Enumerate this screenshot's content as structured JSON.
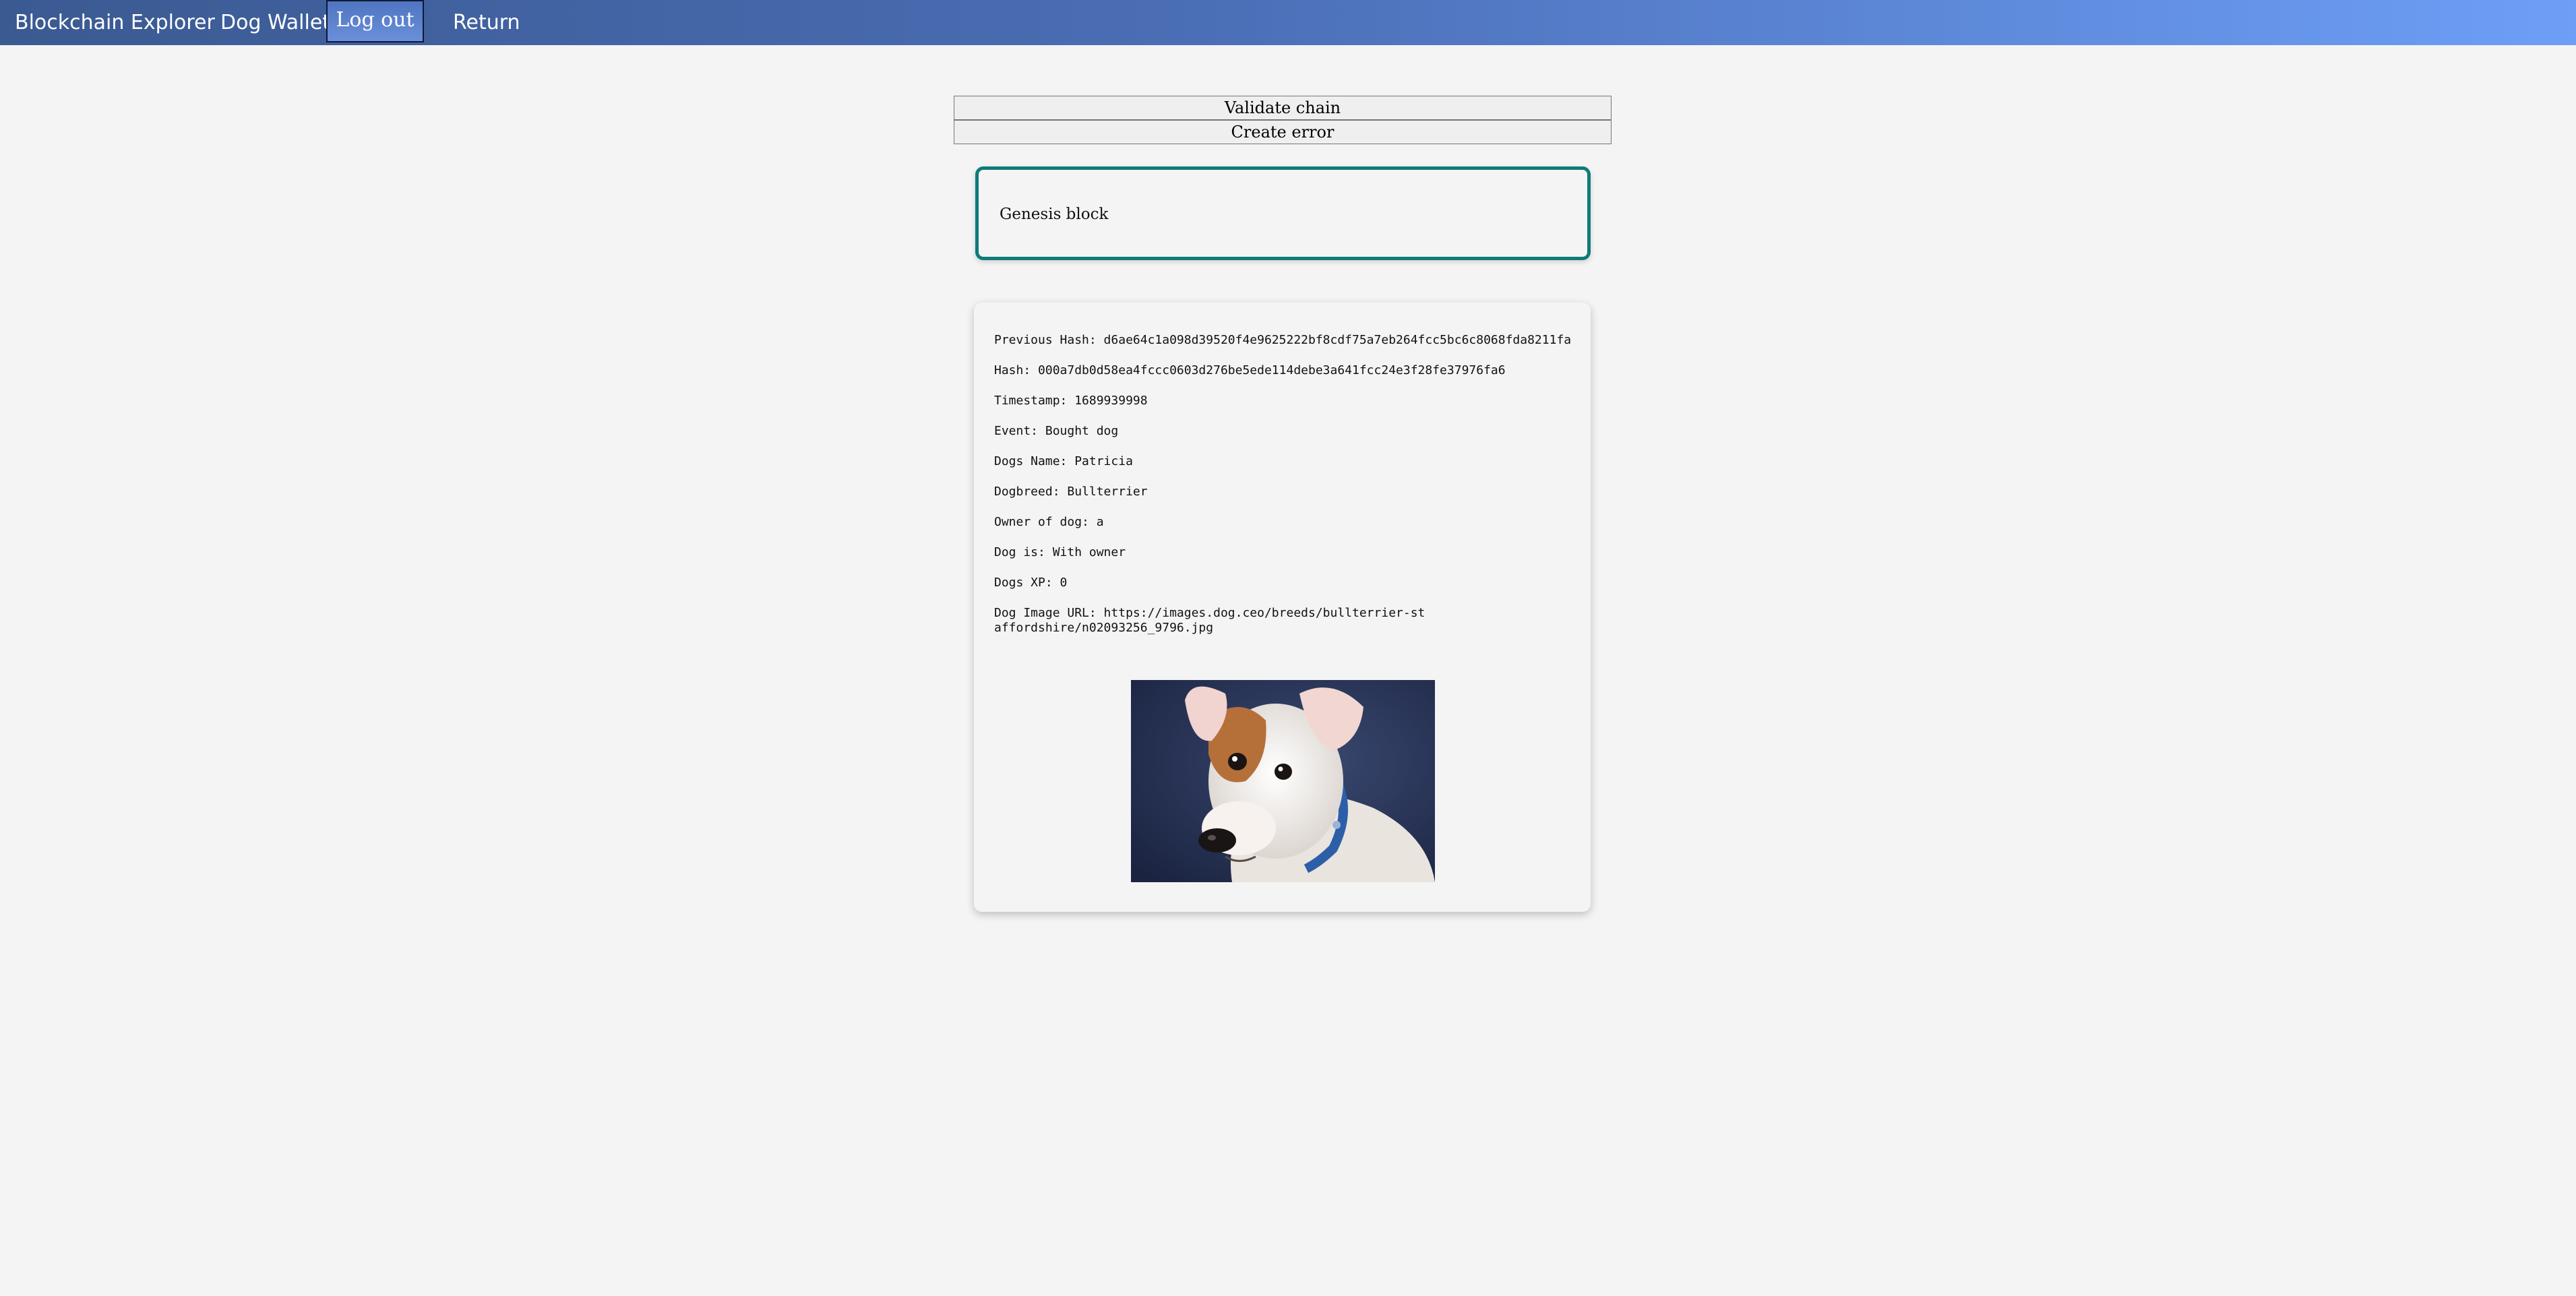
{
  "nav": {
    "explorer": "Blockchain Explorer",
    "wallet": "Dog Wallet",
    "logout": "Log out",
    "return": "Return"
  },
  "actions": {
    "validate": "Validate chain",
    "create_error": "Create error"
  },
  "genesis": {
    "label": "Genesis block"
  },
  "block": {
    "previous_hash": "Previous Hash: d6ae64c1a098d39520f4e9625222bf8cdf75a7eb264fcc5bc6c8068fda8211fa",
    "hash": "Hash: 000a7db0d58ea4fccc0603d276be5ede114debe3a641fcc24e3f28fe37976fa6",
    "timestamp": "Timestamp: 1689939998",
    "event": "Event: Bought dog",
    "dogs_name": "Dogs Name: Patricia",
    "dogbreed": "Dogbreed: Bullterrier",
    "owner": "Owner of dog: a",
    "dog_is": "Dog is: With owner",
    "dogs_xp": "Dogs XP: 0",
    "image_url": "Dog Image URL: https://images.dog.ceo/breeds/bullterrier-staffordshire/n02093256_9796.jpg"
  },
  "colors": {
    "nav_start": "#3b5a92",
    "nav_end": "#6d9ff7",
    "genesis_border": "#0f7a7a",
    "page_bg": "#f4f4f4"
  }
}
